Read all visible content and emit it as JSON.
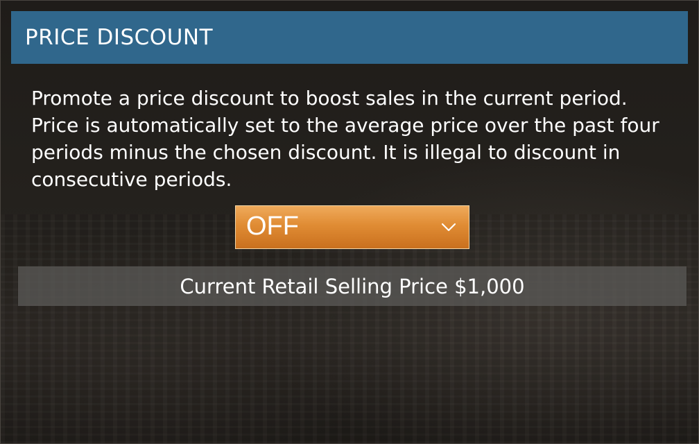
{
  "panel": {
    "title": "PRICE DISCOUNT",
    "description": "Promote a price discount to boost sales in the current period. Price is automatically set to the average price over the past four periods minus the chosen discount. It is illegal to discount in consecutive periods.",
    "discount_select": {
      "selected": "OFF",
      "icon": "chevron-down-icon"
    },
    "price_info": "Current Retail Selling Price $1,000"
  },
  "colors": {
    "header": "#30678c",
    "dropdown": "#e08c34",
    "background": "#1f1c19"
  }
}
